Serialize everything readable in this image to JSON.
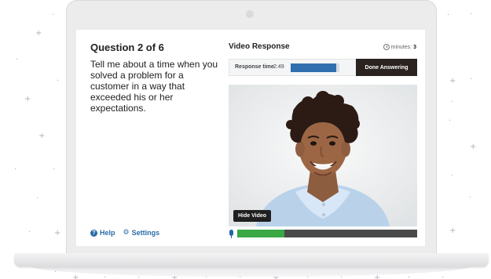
{
  "question": {
    "title": "Question 2 of 6",
    "text": "Tell me about a time when you solved a problem for a customer in a way that exceeded his or her expectations."
  },
  "footer": {
    "help": "Help",
    "settings": "Settings"
  },
  "video": {
    "title": "Video Response",
    "minutes_label": "minutes:",
    "minutes_value": "3",
    "response_label": "Response time",
    "response_time": "2:49",
    "response_progress": 0.93,
    "done_button": "Done Answering",
    "hide_button": "Hide Video",
    "audio_level": 0.26
  },
  "icons": {
    "help": "help-icon",
    "settings": "gear-icon",
    "clock": "clock-icon",
    "microphone": "microphone-icon",
    "camera": "webcam-dot"
  },
  "colors": {
    "accent": "#2b6ca8",
    "progress": "#2f6fae",
    "audio": "#39a845",
    "button_dark": "#2b2320"
  }
}
